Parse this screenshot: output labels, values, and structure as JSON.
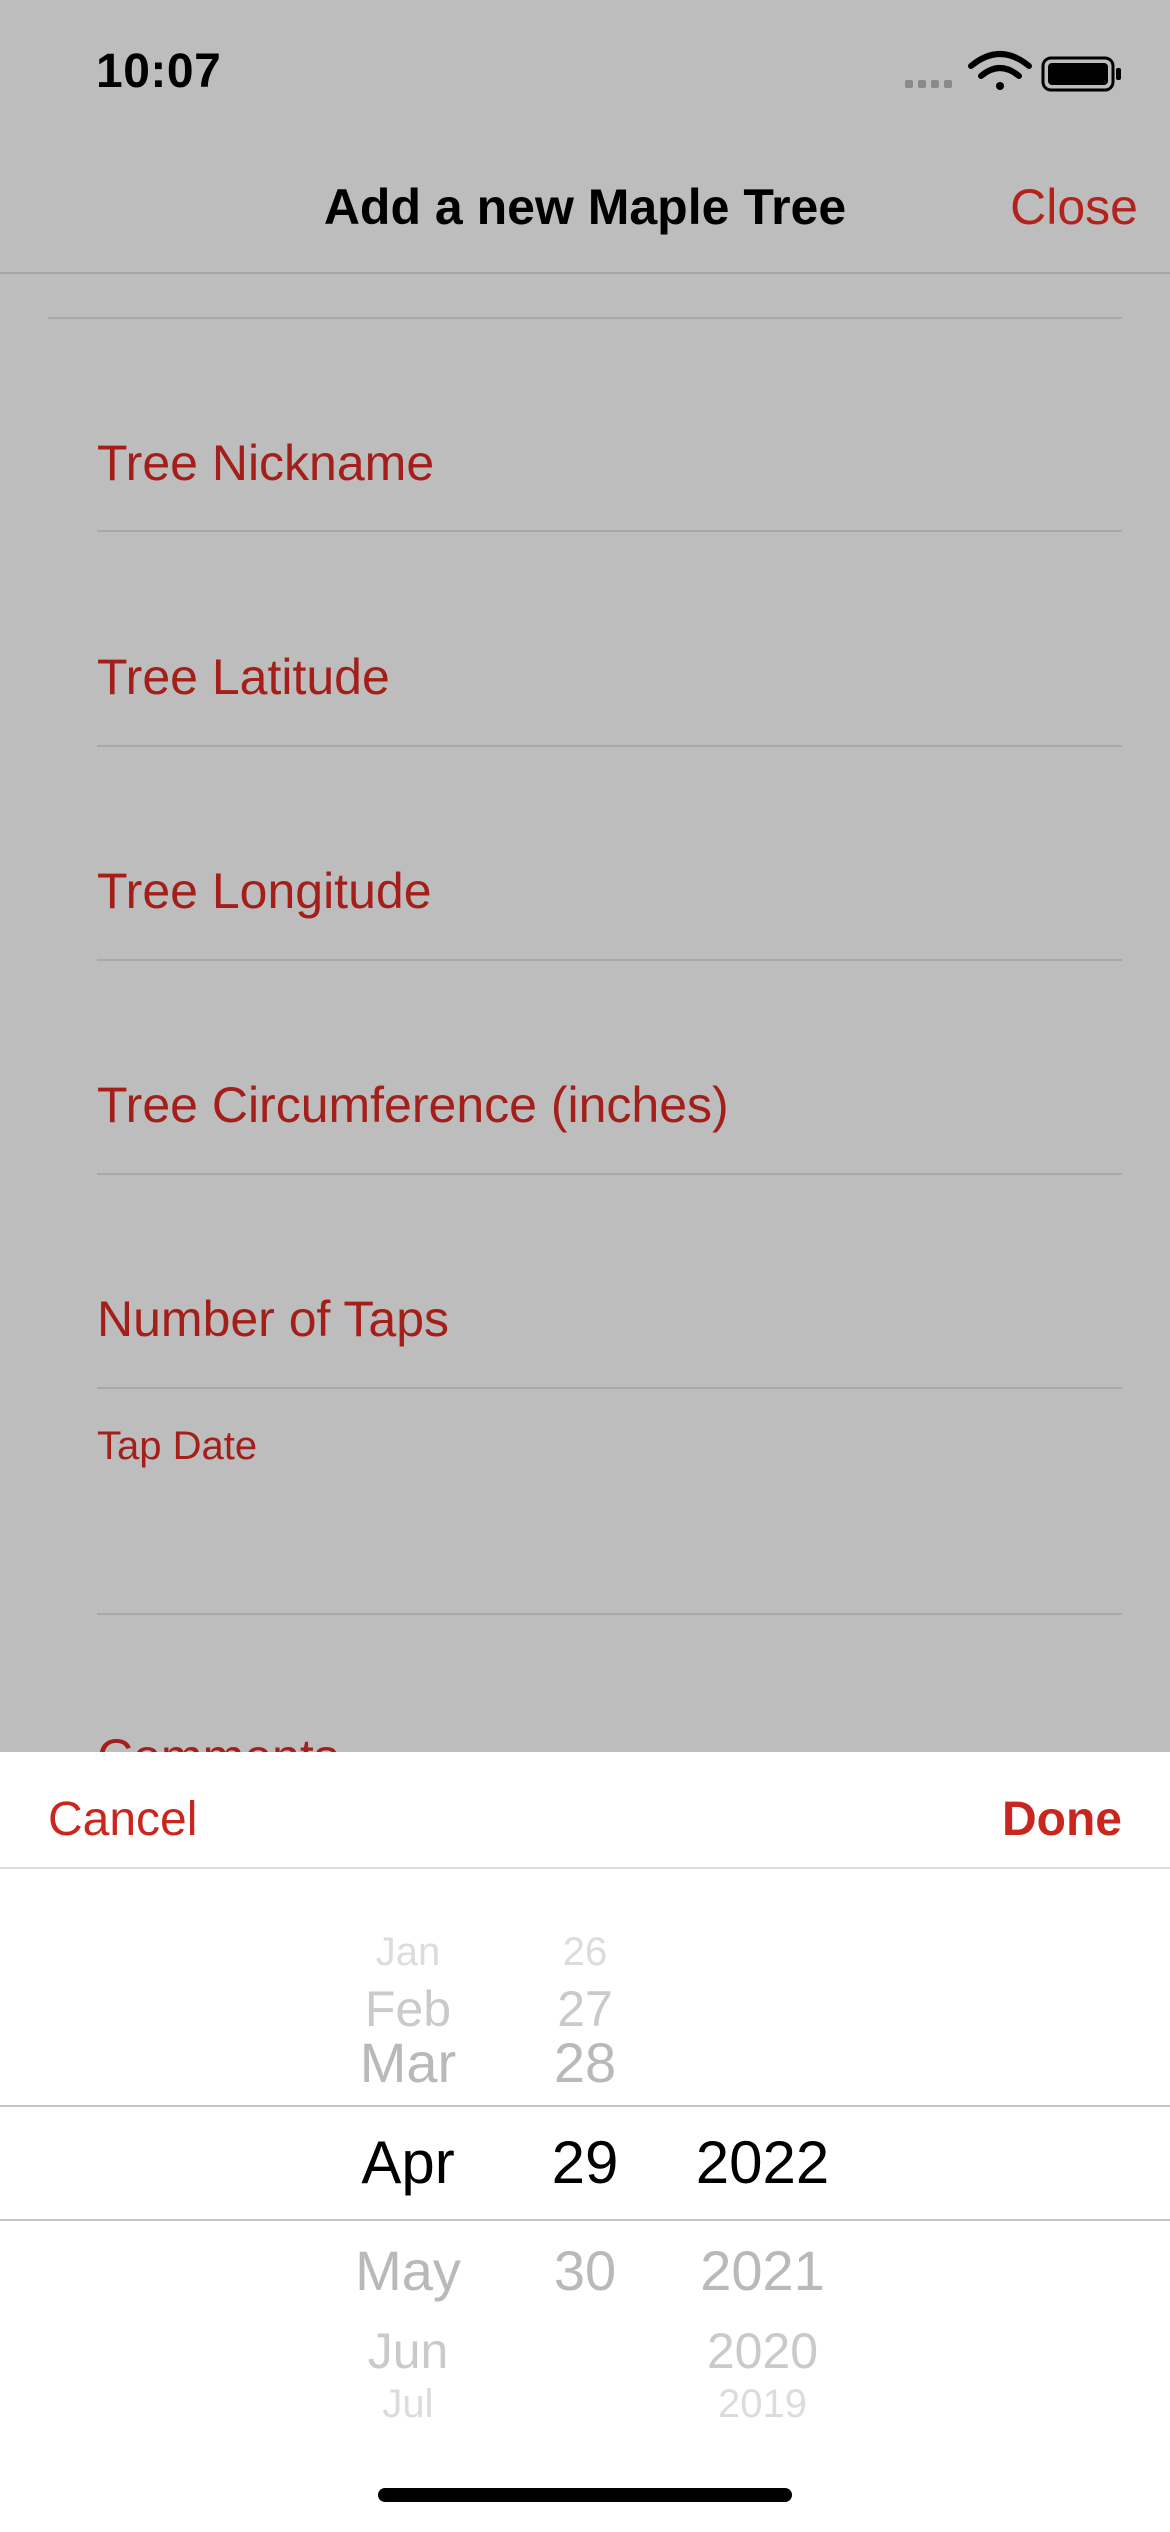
{
  "status_bar": {
    "time": "10:07"
  },
  "nav": {
    "title": "Add a new Maple Tree",
    "close_label": "Close"
  },
  "form": {
    "fields": [
      "Tree Nickname",
      "Tree Latitude",
      "Tree Longitude",
      "Tree Circumference (inches)",
      "Number of Taps"
    ],
    "tap_date_label": "Tap Date",
    "partial_next_label": "Comments"
  },
  "picker_sheet": {
    "cancel_label": "Cancel",
    "done_label": "Done",
    "month_items": [
      "Jan",
      "Feb",
      "Mar",
      "Apr",
      "May",
      "Jun",
      "Jul"
    ],
    "day_items": [
      "26",
      "27",
      "28",
      "29",
      "30"
    ],
    "year_items": [
      "2022",
      "2021",
      "2020",
      "2019"
    ],
    "selected": {
      "month": "Apr",
      "day": "29",
      "year": "2022"
    }
  },
  "colors": {
    "accent": "#c9261e",
    "dim_background": "#bdbdbd"
  }
}
